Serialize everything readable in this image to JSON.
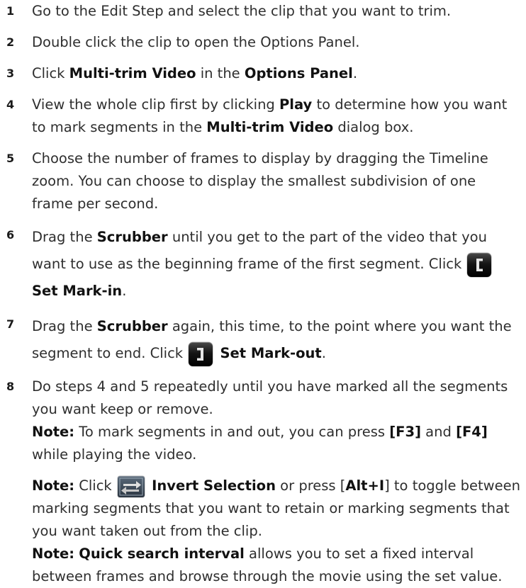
{
  "steps": [
    {
      "num": "1",
      "text": "Go to the Edit Step and select the clip that you want to trim."
    },
    {
      "num": "2",
      "text": "Double click the clip to open the Options Panel."
    },
    {
      "num": "3",
      "t1": "Click ",
      "b1": "Multi-trim Video",
      "t2": " in the ",
      "b2": "Options Panel",
      "t3": "."
    },
    {
      "num": "4",
      "t1": "View the whole clip first by clicking ",
      "b1": "Play",
      "t2": " to determine how you want to mark segments in the ",
      "b2": "Multi-trim Video",
      "t3": " dialog box."
    },
    {
      "num": "5",
      "text": "Choose the number of frames to display by dragging the Timeline zoom. You can choose to display the smallest subdivision of one frame per second."
    },
    {
      "num": "6",
      "t1": "Drag the ",
      "b1": "Scrubber",
      "t2": " until you get to the part of the video that you want to use as the beginning frame of the first segment. Click ",
      "b2": "Set Mark-in",
      "t3": "."
    },
    {
      "num": "7",
      "t1": "Drag the ",
      "b1": "Scrubber",
      "t2": " again, this time, to the point where you want the segment to end. Click ",
      "b2": "Set Mark-out",
      "t3": "."
    },
    {
      "num": "8",
      "text": "Do steps 4 and 5 repeatedly until you have marked all the segments you want keep or remove."
    }
  ],
  "notes": [
    {
      "label": "Note:",
      "t1": " To mark segments in and out, you can press ",
      "k1": "[F3]",
      "t2": " and ",
      "k2": "[F4]",
      "t3": " while playing the video."
    },
    {
      "label": "Note:",
      "t1": " Click ",
      "b1": "Invert Selection",
      "t2": " or press [",
      "k1": "Alt+I",
      "t3": "] to toggle between marking segments that you want to retain or marking segments that you want taken out from the clip."
    },
    {
      "label": "Note:",
      "b1": "Quick search interval",
      "t1": " allows you to set a fixed interval between frames and browse through the movie using the set value."
    }
  ],
  "icons": {
    "mark_in": "mark-in-bracket-icon",
    "mark_out": "mark-out-bracket-icon",
    "invert": "invert-selection-arrows-icon"
  }
}
